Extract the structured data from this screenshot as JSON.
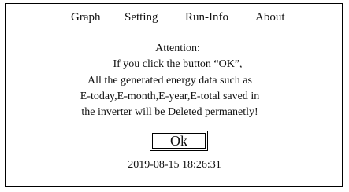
{
  "menu": {
    "items": [
      {
        "label": "Graph"
      },
      {
        "label": "Setting"
      },
      {
        "label": "Run-Info"
      },
      {
        "label": "About"
      }
    ]
  },
  "dialog": {
    "title": "Attention:",
    "lines": [
      "If you click the button “OK”,",
      "All the  generated energy data such as",
      "E-today,E-month,E-year,E-total saved in",
      "the inverter will be Deleted permanetly!"
    ],
    "ok_label": "Ok"
  },
  "status": {
    "datetime": "2019-08-15 18:26:31"
  }
}
